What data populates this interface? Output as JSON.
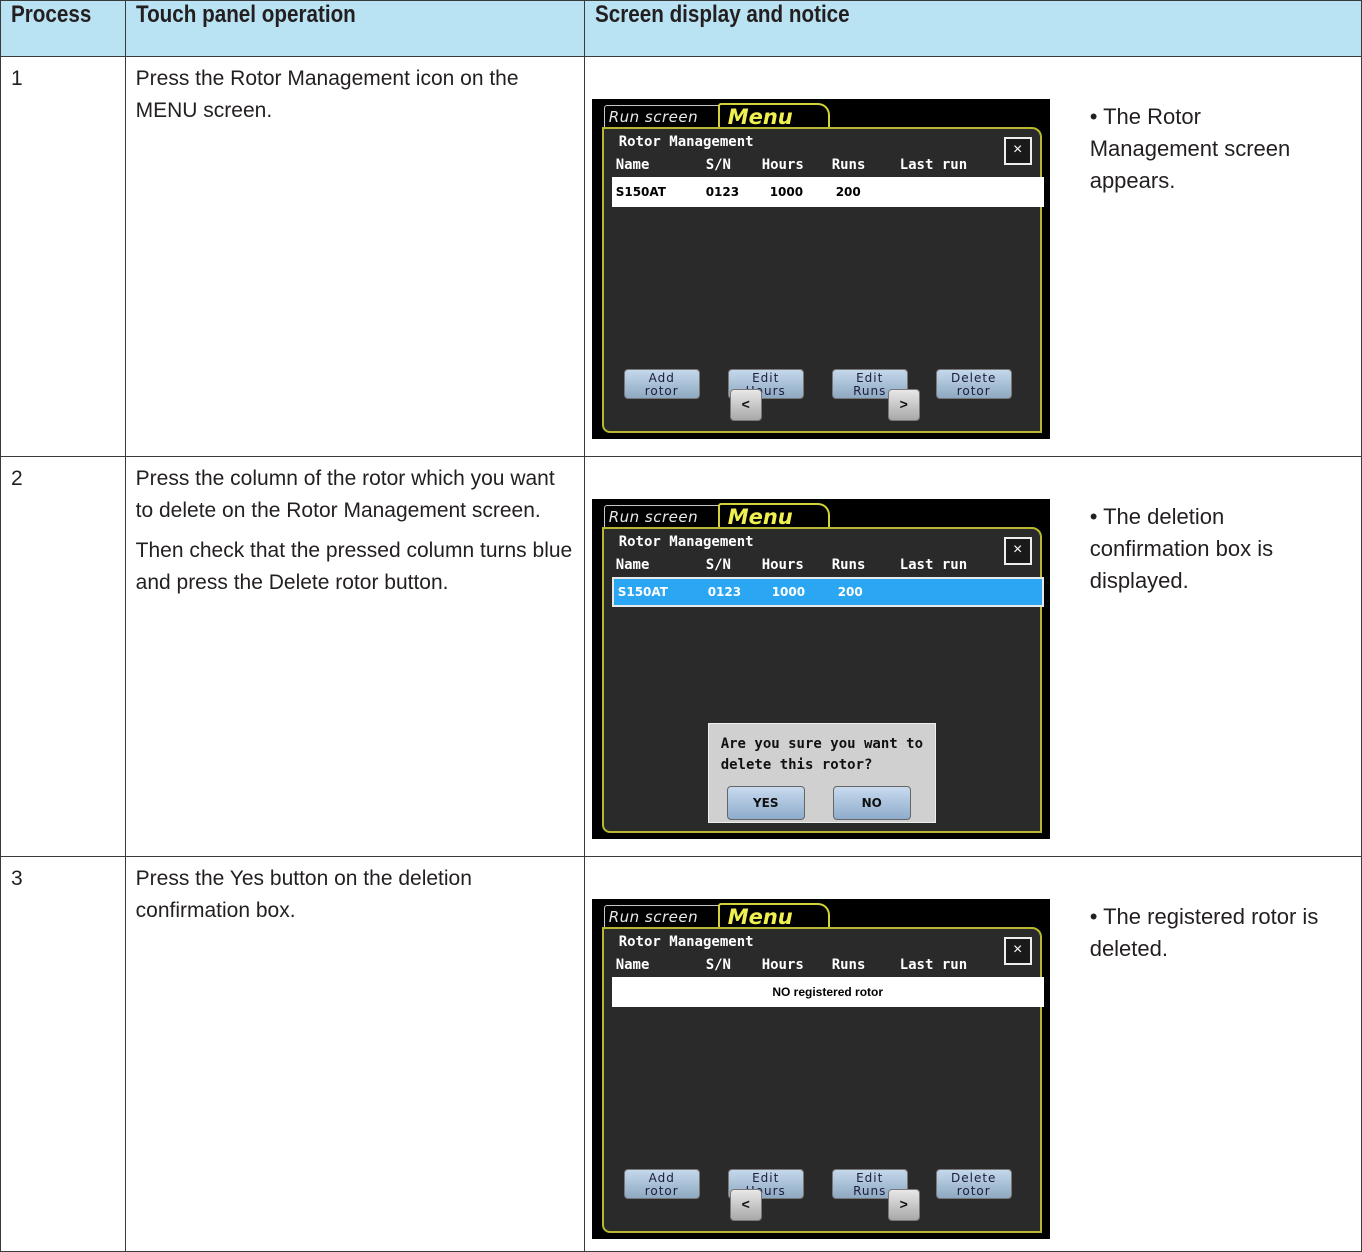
{
  "headers": {
    "process": "Process",
    "operation": "Touch panel operation",
    "display": "Screen display and notice"
  },
  "steps": [
    {
      "num": "1",
      "operation": [
        "Press the Rotor Management icon on the MENU screen."
      ],
      "notice": "• The Rotor Management screen appears.",
      "screen": {
        "tab_run": "Run screen",
        "tab_menu": "Menu",
        "title": "Rotor Management",
        "close": "×",
        "columns": [
          "Name",
          "S/N",
          "Hours",
          "Runs",
          "Last run"
        ],
        "row": [
          "S150AT",
          "0123",
          "1000",
          "200"
        ],
        "buttons": [
          "Add\nrotor",
          "Edit\nHours",
          "Edit\nRuns",
          "Delete\nrotor"
        ],
        "prev": "<",
        "next": ">"
      }
    },
    {
      "num": "2",
      "operation": [
        "Press the column of the rotor which you want to delete on the Rotor Management screen.",
        "Then check that the pressed column turns blue and press the Delete rotor button."
      ],
      "notice": "• The deletion confirmation box is displayed.",
      "screen": {
        "tab_run": "Run screen",
        "tab_menu": "Menu",
        "title": "Rotor Management",
        "close": "×",
        "columns": [
          "Name",
          "S/N",
          "Hours",
          "Runs",
          "Last run"
        ],
        "row": [
          "S150AT",
          "0123",
          "1000",
          "200"
        ],
        "dialog_message": "Are you sure you want to delete this rotor?",
        "dialog_yes": "YES",
        "dialog_no": "NO"
      }
    },
    {
      "num": "3",
      "operation": [
        "Press the Yes button on the deletion confirmation box."
      ],
      "notice": "• The registered rotor is deleted.",
      "screen": {
        "tab_run": "Run screen",
        "tab_menu": "Menu",
        "title": "Rotor Management",
        "close": "×",
        "columns": [
          "Name",
          "S/N",
          "Hours",
          "Runs",
          "Last run"
        ],
        "empty_text": "NO registered rotor",
        "buttons": [
          "Add\nrotor",
          "Edit\nHours",
          "Edit\nRuns",
          "Delete\nrotor"
        ],
        "prev": "<",
        "next": ">"
      }
    }
  ],
  "colors": {
    "header_bg": "#b9e3f2",
    "menu_tab": "#f0f050",
    "panel_border": "#b8b830",
    "selected_row": "#2aa6f2"
  }
}
